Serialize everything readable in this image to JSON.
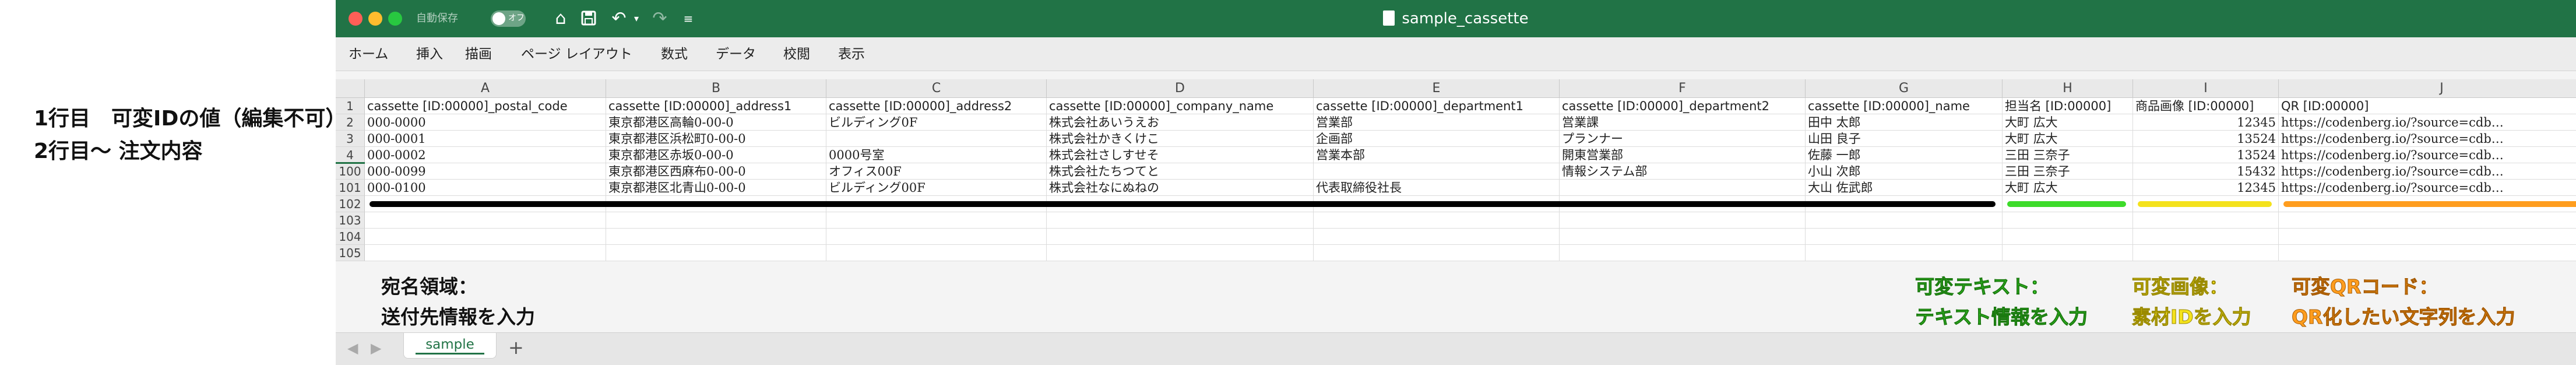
{
  "side_note": {
    "line1": "1行目　可変IDの値（編集不可）",
    "line2": "2行目〜 注文内容"
  },
  "window": {
    "autosave_label": "自動保存",
    "autosave_state": "オフ",
    "title": "sample_cassette",
    "toolbar_icons": [
      "home-icon",
      "save-icon",
      "undo-icon",
      "redo-icon",
      "customize-icon"
    ]
  },
  "ribbon": {
    "tabs": [
      "ホーム",
      "挿入",
      "描画",
      "ページ レイアウト",
      "数式",
      "データ",
      "校閲",
      "表示"
    ]
  },
  "columns": [
    "A",
    "B",
    "C",
    "D",
    "E",
    "F",
    "G",
    "H",
    "I",
    "J"
  ],
  "rows": [
    {
      "num": "1",
      "cells": [
        "cassette [ID:00000]_postal_code",
        "cassette [ID:00000]_address1",
        "cassette [ID:00000]_address2",
        "cassette [ID:00000]_company_name",
        "cassette [ID:00000]_department1",
        "cassette [ID:00000]_department2",
        "cassette [ID:00000]_name",
        "担当名 [ID:00000]",
        "商品画像 [ID:00000]",
        "QR [ID:00000]"
      ]
    },
    {
      "num": "2",
      "cells": [
        "000-0000",
        "東京都港区高輪0-00-0",
        "ビルディング0F",
        "株式会社あいうえお",
        "営業部",
        "営業課",
        "田中 太郎",
        "大町 広大",
        "12345",
        "https://codenberg.io/?source=cdb…"
      ]
    },
    {
      "num": "3",
      "cells": [
        "000-0001",
        "東京都港区浜松町0-00-0",
        "",
        "株式会社かきくけこ",
        "企画部",
        "プランナー",
        "山田 良子",
        "大町 広大",
        "13524",
        "https://codenberg.io/?source=cdb…"
      ]
    },
    {
      "num": "4",
      "cells": [
        "000-0002",
        "東京都港区赤坂0-00-0",
        "0000号室",
        "株式会社さしすせそ",
        "営業本部",
        "開東営業部",
        "佐藤 一郎",
        "三田 三奈子",
        "13524",
        "https://codenberg.io/?source=cdb…"
      ]
    },
    {
      "num": "100",
      "cells": [
        "000-0099",
        "東京都港区西麻布0-00-0",
        "オフィス00F",
        "株式会社たちつてと",
        "",
        "情報システム部",
        "小山 次郎",
        "三田 三奈子",
        "15432",
        "https://codenberg.io/?source=cdb…"
      ]
    },
    {
      "num": "101",
      "cells": [
        "000-0100",
        "東京都港区北青山0-00-0",
        "ビルディング00F",
        "株式会社なにぬねの",
        "代表取締役社長",
        "",
        "大山 佐武郎",
        "大町 広大",
        "12345",
        "https://codenberg.io/?source=cdb…"
      ]
    },
    {
      "num": "102",
      "cells": [
        "",
        "",
        "",
        "",
        "",
        "",
        "",
        "",
        "",
        ""
      ]
    },
    {
      "num": "103",
      "cells": [
        "",
        "",
        "",
        "",
        "",
        "",
        "",
        "",
        "",
        ""
      ]
    },
    {
      "num": "104",
      "cells": [
        "",
        "",
        "",
        "",
        "",
        "",
        "",
        "",
        "",
        ""
      ]
    },
    {
      "num": "105",
      "cells": [
        "",
        "",
        "",
        "",
        "",
        "",
        "",
        "",
        "",
        ""
      ]
    }
  ],
  "numeric_columns": [
    8
  ],
  "bars": [
    {
      "name": "address-area-bar",
      "color": "#000000"
    },
    {
      "name": "variable-text-bar",
      "color": "#3ddb2a"
    },
    {
      "name": "variable-image-bar",
      "color": "#f4e21c"
    },
    {
      "name": "variable-qr-bar",
      "color": "#ff9d1e"
    }
  ],
  "notes": {
    "address": {
      "line1": "宛名領域：",
      "line2": "送付先情報を入力"
    },
    "text": {
      "line1": "可変テキスト：",
      "line2": "テキスト情報を入力"
    },
    "image": {
      "line1": "可変画像：",
      "line2": "素材IDを入力"
    },
    "qr": {
      "line1": "可変QRコード：",
      "line2": "QR化したい文字列を入力"
    }
  },
  "sheet_tabs": [
    "sample"
  ],
  "colors": {
    "excel_green": "#217346",
    "text_note": "#3ddb2a",
    "image_note": "#f4e21c",
    "qr_note": "#ff9d1e"
  }
}
